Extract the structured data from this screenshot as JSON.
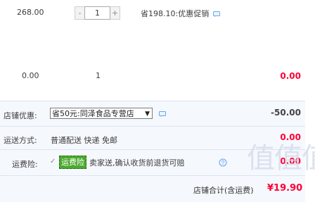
{
  "item": {
    "price": "268.00",
    "qty": "1",
    "qty_minus": "-",
    "qty_plus": "+",
    "promo": "省198.10:优惠促销"
  },
  "subtotal": {
    "left_value": "0.00",
    "count": "1",
    "total": "0.00"
  },
  "shop_discount": {
    "label": "店铺优惠:",
    "selected": "省50元:同泽食品专营店",
    "value": "-50.00"
  },
  "shipping": {
    "label": "运送方式:",
    "value": "普通配送 快递 免邮",
    "total": "0.00"
  },
  "insurance": {
    "label": "运费险:",
    "tag": "运费险",
    "text": "卖家送,确认收货前退货可赔",
    "total": "0.00"
  },
  "summary": {
    "label": "店铺合计(含运费)",
    "value": "¥19.90"
  },
  "watermark": "值值值",
  "colors": {
    "price_red": "#ff0036",
    "panel_bg": "#f5f8fd",
    "tag_green": "#4aaa2e",
    "icon_blue": "#6aa6e8"
  }
}
